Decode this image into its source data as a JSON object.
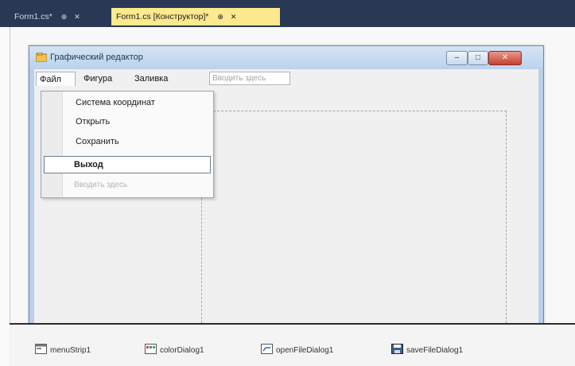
{
  "ide_tabs": [
    {
      "label": "Form1.cs*",
      "pin": "⊕",
      "close": "✕"
    },
    {
      "label": "Form1.cs [Конструктор]*",
      "pin": "⊕",
      "close": "✕"
    }
  ],
  "form": {
    "title": "Графический редактор",
    "buttons": {
      "minimize": "–",
      "maximize": "□",
      "close": "✕"
    }
  },
  "menubar": {
    "items": [
      "Файл",
      "Фигура",
      "Заливка"
    ],
    "type_here": "Вводить здесь"
  },
  "file_menu": {
    "items": [
      "Система координат",
      "Открыть",
      "Сохранить",
      "Выход"
    ],
    "selected": "Выход",
    "type_here": "Вводить здесь"
  },
  "component_tray": [
    "menuStrip1",
    "colorDialog1",
    "openFileDialog1",
    "saveFileDialog1"
  ],
  "colors": {
    "ide_tabbar": "#293955",
    "active_tab": "#fde98e",
    "form_border": "#6d86ad",
    "close_button": "#c6402c"
  }
}
